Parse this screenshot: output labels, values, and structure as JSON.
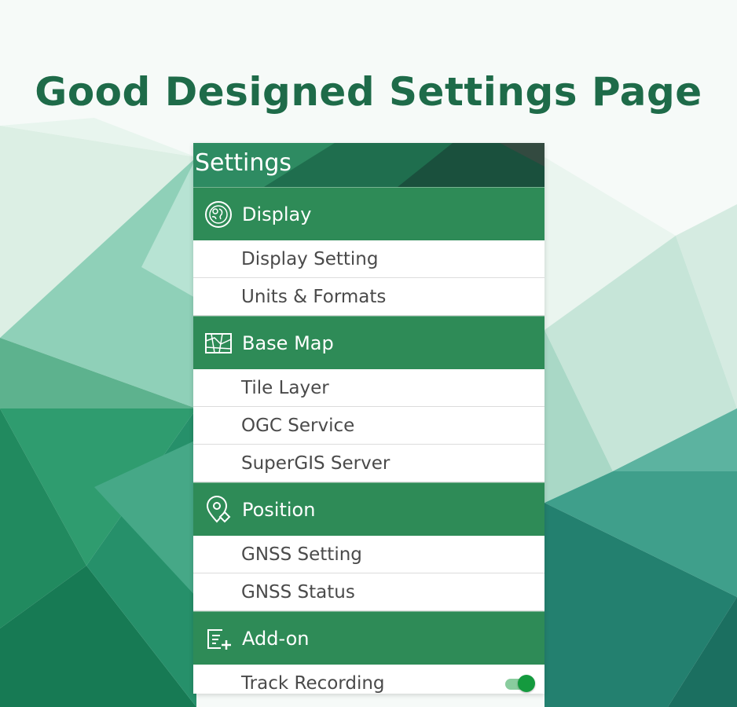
{
  "headline": "Good Designed Settings Page",
  "colors": {
    "headline": "#1e6b49",
    "section_green": "#2e8b57",
    "appbar_dark": "#1b4f3c",
    "toggle_on": "#149a3e",
    "text_gray": "#4a4a4a"
  },
  "appbar": {
    "title": "Settings"
  },
  "sections": [
    {
      "title": "Display",
      "icon": "globe-icon",
      "items": [
        {
          "label": "Display Setting"
        },
        {
          "label": "Units & Formats"
        }
      ]
    },
    {
      "title": "Base Map",
      "icon": "map-icon",
      "items": [
        {
          "label": "Tile Layer"
        },
        {
          "label": "OGC Service"
        },
        {
          "label": "SuperGIS Server"
        }
      ]
    },
    {
      "title": "Position",
      "icon": "location-pin-icon",
      "items": [
        {
          "label": "GNSS Setting"
        },
        {
          "label": "GNSS Status"
        }
      ]
    },
    {
      "title": "Add-on",
      "icon": "add-note-icon",
      "items": [
        {
          "label": "Track Recording",
          "toggle": true
        }
      ]
    }
  ]
}
